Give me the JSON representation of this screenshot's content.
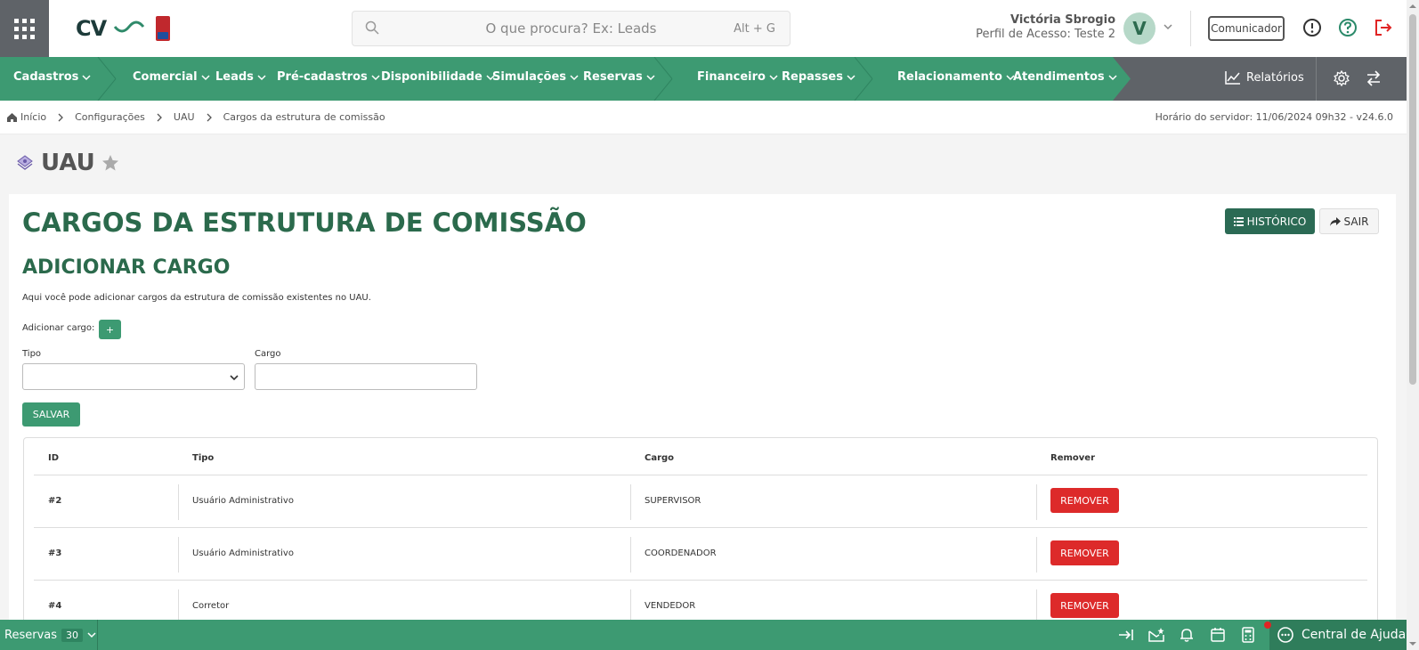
{
  "header": {
    "search_placeholder": "O que procura? Ex: Leads",
    "search_shortcut": "Alt + G",
    "user_name": "Victória Sbrogio",
    "user_profile": "Perfil de Acesso: Teste 2",
    "avatar_initial": "V",
    "comunicador_label": "Comunicador"
  },
  "nav": {
    "items": [
      {
        "label": "Cadastros"
      },
      {
        "label": "Comercial"
      },
      {
        "label": "Leads"
      },
      {
        "label": "Pré-cadastros"
      },
      {
        "label": "Disponibilidade"
      },
      {
        "label": "Simulações"
      },
      {
        "label": "Reservas"
      },
      {
        "label": "Financeiro"
      },
      {
        "label": "Repasses"
      },
      {
        "label": "Relacionamento"
      },
      {
        "label": "Atendimentos"
      }
    ],
    "reports_label": "Relatórios"
  },
  "breadcrumb": {
    "items": [
      "Início",
      "Configurações",
      "UAU",
      "Cargos da estrutura de comissão"
    ],
    "server_time": "Horário do servidor: 11/06/2024 09h32 - v24.6.0"
  },
  "page": {
    "title": "UAU",
    "heading": "CARGOS DA ESTRUTURA DE COMISSÃO",
    "subheading": "ADICIONAR CARGO",
    "description": "Aqui você pode adicionar cargos da estrutura de comissão existentes no UAU.",
    "add_label": "Adicionar cargo:",
    "add_button": "+",
    "history_button": "HISTÓRICO",
    "exit_button": "SAIR",
    "tipo_label": "Tipo",
    "cargo_label": "Cargo",
    "tipo_value": "",
    "cargo_value": "",
    "save_button": "SALVAR"
  },
  "table": {
    "headers": [
      "ID",
      "Tipo",
      "Cargo",
      "Remover"
    ],
    "rows": [
      {
        "id": "#2",
        "tipo": "Usuário Administrativo",
        "cargo": "SUPERVISOR",
        "action": "REMOVER"
      },
      {
        "id": "#3",
        "tipo": "Usuário Administrativo",
        "cargo": "COORDENADOR",
        "action": "REMOVER"
      },
      {
        "id": "#4",
        "tipo": "Corretor",
        "cargo": "VENDEDOR",
        "action": "REMOVER"
      }
    ]
  },
  "footer": {
    "reservas_label": "Reservas",
    "reservas_count": "30",
    "help_label": "Central de Ajuda"
  },
  "colors": {
    "brand_green": "#3d9a72",
    "dark_green": "#2b6a4c",
    "nav_gray": "#5f6368",
    "danger": "#dd2a2a"
  },
  "icons": [
    "apps-grid-icon",
    "search-icon",
    "chevron-down-icon",
    "info-icon",
    "help-icon",
    "logout-icon",
    "chart-icon",
    "gear-icon",
    "swap-icon",
    "home-icon",
    "puzzle-icon",
    "star-icon",
    "list-icon",
    "share-icon",
    "collapse-icon",
    "mail-star-icon",
    "bell-icon",
    "calendar-icon",
    "calculator-icon",
    "chat-icon"
  ]
}
